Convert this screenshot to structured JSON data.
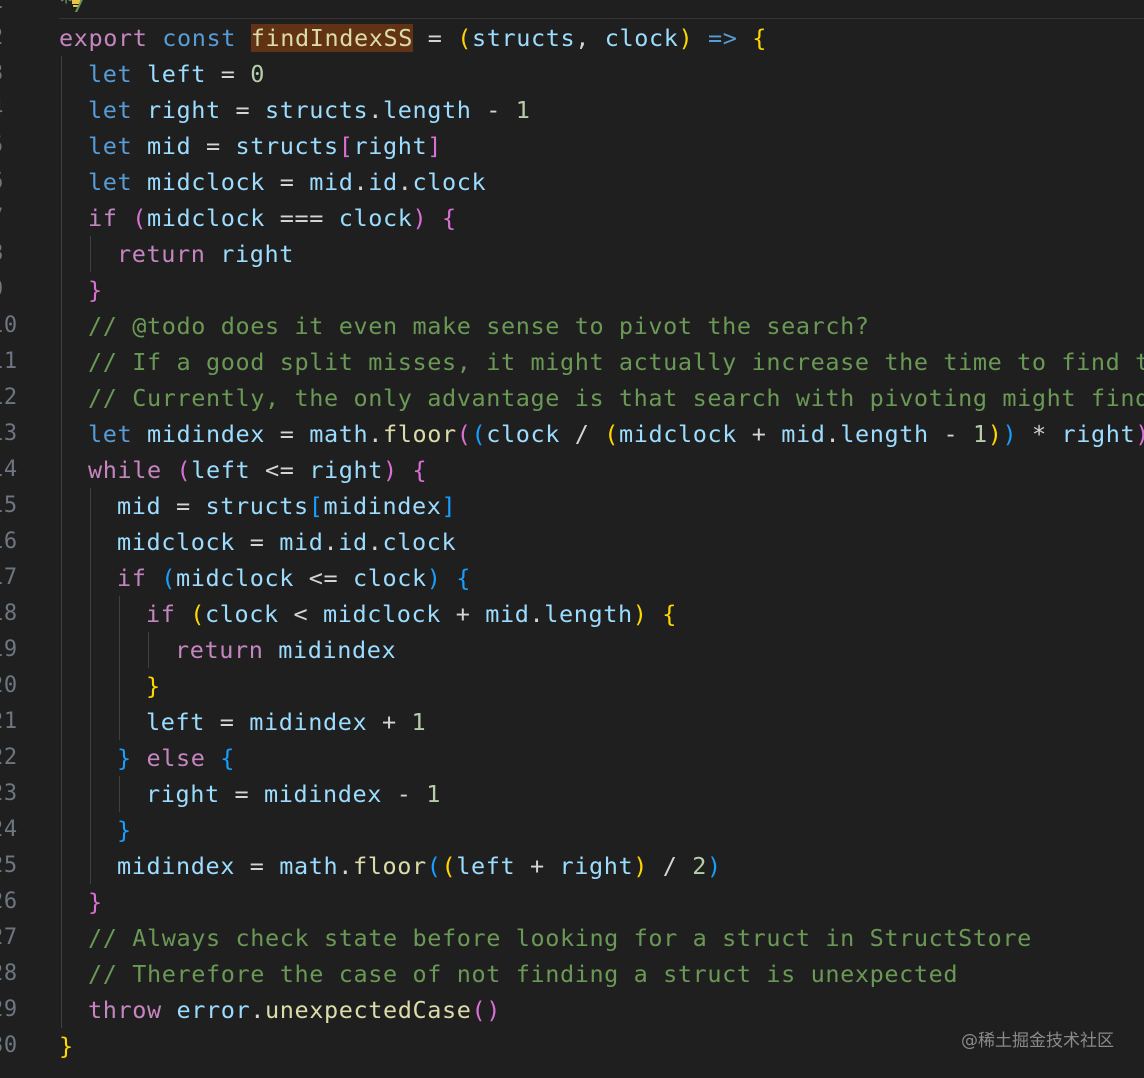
{
  "editor": {
    "lines": [
      {
        "n": "1",
        "indent": 0,
        "tokens": [
          {
            "t": "*/",
            "c": "k-cm"
          }
        ]
      },
      {
        "n": "2",
        "indent": 0,
        "tokens": [
          {
            "t": "export",
            "c": "k-kw"
          },
          {
            "t": " ",
            "c": "k-op"
          },
          {
            "t": "const",
            "c": "k-st"
          },
          {
            "t": " ",
            "c": "k-op"
          },
          {
            "t": "findIndexSS",
            "c": "k-fn hl"
          },
          {
            "t": " = ",
            "c": "k-op"
          },
          {
            "t": "(",
            "c": "k-b1"
          },
          {
            "t": "structs",
            "c": "k-var"
          },
          {
            "t": ", ",
            "c": "k-op"
          },
          {
            "t": "clock",
            "c": "k-var"
          },
          {
            "t": ")",
            "c": "k-b1"
          },
          {
            "t": " ",
            "c": "k-op"
          },
          {
            "t": "=>",
            "c": "k-st"
          },
          {
            "t": " ",
            "c": "k-op"
          },
          {
            "t": "{",
            "c": "k-b1"
          }
        ]
      },
      {
        "n": "3",
        "indent": 1,
        "tokens": [
          {
            "t": "let",
            "c": "k-st"
          },
          {
            "t": " ",
            "c": "k-op"
          },
          {
            "t": "left",
            "c": "k-var"
          },
          {
            "t": " = ",
            "c": "k-op"
          },
          {
            "t": "0",
            "c": "k-num"
          }
        ]
      },
      {
        "n": "4",
        "indent": 1,
        "tokens": [
          {
            "t": "let",
            "c": "k-st"
          },
          {
            "t": " ",
            "c": "k-op"
          },
          {
            "t": "right",
            "c": "k-var"
          },
          {
            "t": " = ",
            "c": "k-op"
          },
          {
            "t": "structs",
            "c": "k-var"
          },
          {
            "t": ".",
            "c": "k-op"
          },
          {
            "t": "length",
            "c": "k-var"
          },
          {
            "t": " - ",
            "c": "k-op"
          },
          {
            "t": "1",
            "c": "k-num"
          }
        ]
      },
      {
        "n": "5",
        "indent": 1,
        "tokens": [
          {
            "t": "let",
            "c": "k-st"
          },
          {
            "t": " ",
            "c": "k-op"
          },
          {
            "t": "mid",
            "c": "k-var"
          },
          {
            "t": " = ",
            "c": "k-op"
          },
          {
            "t": "structs",
            "c": "k-var"
          },
          {
            "t": "[",
            "c": "k-b2"
          },
          {
            "t": "right",
            "c": "k-var"
          },
          {
            "t": "]",
            "c": "k-b2"
          }
        ]
      },
      {
        "n": "6",
        "indent": 1,
        "tokens": [
          {
            "t": "let",
            "c": "k-st"
          },
          {
            "t": " ",
            "c": "k-op"
          },
          {
            "t": "midclock",
            "c": "k-var"
          },
          {
            "t": " = ",
            "c": "k-op"
          },
          {
            "t": "mid",
            "c": "k-var"
          },
          {
            "t": ".",
            "c": "k-op"
          },
          {
            "t": "id",
            "c": "k-var"
          },
          {
            "t": ".",
            "c": "k-op"
          },
          {
            "t": "clock",
            "c": "k-var"
          }
        ]
      },
      {
        "n": "7",
        "indent": 1,
        "tokens": [
          {
            "t": "if",
            "c": "k-kw"
          },
          {
            "t": " ",
            "c": "k-op"
          },
          {
            "t": "(",
            "c": "k-b2"
          },
          {
            "t": "midclock",
            "c": "k-var"
          },
          {
            "t": " === ",
            "c": "k-op"
          },
          {
            "t": "clock",
            "c": "k-var"
          },
          {
            "t": ")",
            "c": "k-b2"
          },
          {
            "t": " ",
            "c": "k-op"
          },
          {
            "t": "{",
            "c": "k-b2"
          }
        ]
      },
      {
        "n": "8",
        "indent": 2,
        "tokens": [
          {
            "t": "return",
            "c": "k-kw"
          },
          {
            "t": " ",
            "c": "k-op"
          },
          {
            "t": "right",
            "c": "k-var"
          }
        ]
      },
      {
        "n": "9",
        "indent": 1,
        "tokens": [
          {
            "t": "}",
            "c": "k-b2"
          }
        ]
      },
      {
        "n": "10",
        "indent": 1,
        "tokens": [
          {
            "t": "// @todo does it even make sense to pivot the search?",
            "c": "k-cm"
          }
        ]
      },
      {
        "n": "11",
        "indent": 1,
        "tokens": [
          {
            "t": "// If a good split misses, it might actually increase the time to find the",
            "c": "k-cm"
          }
        ]
      },
      {
        "n": "12",
        "indent": 1,
        "tokens": [
          {
            "t": "// Currently, the only advantage is that search with pivoting might find t",
            "c": "k-cm"
          }
        ]
      },
      {
        "n": "13",
        "indent": 1,
        "tokens": [
          {
            "t": "let",
            "c": "k-st"
          },
          {
            "t": " ",
            "c": "k-op"
          },
          {
            "t": "midindex",
            "c": "k-var"
          },
          {
            "t": " = ",
            "c": "k-op"
          },
          {
            "t": "math",
            "c": "k-var"
          },
          {
            "t": ".",
            "c": "k-op"
          },
          {
            "t": "floor",
            "c": "k-fn"
          },
          {
            "t": "(",
            "c": "k-b2"
          },
          {
            "t": "(",
            "c": "k-b3"
          },
          {
            "t": "clock",
            "c": "k-var"
          },
          {
            "t": " / ",
            "c": "k-op"
          },
          {
            "t": "(",
            "c": "k-b1"
          },
          {
            "t": "midclock",
            "c": "k-var"
          },
          {
            "t": " + ",
            "c": "k-op"
          },
          {
            "t": "mid",
            "c": "k-var"
          },
          {
            "t": ".",
            "c": "k-op"
          },
          {
            "t": "length",
            "c": "k-var"
          },
          {
            "t": " - ",
            "c": "k-op"
          },
          {
            "t": "1",
            "c": "k-num"
          },
          {
            "t": ")",
            "c": "k-b1"
          },
          {
            "t": ")",
            "c": "k-b3"
          },
          {
            "t": " * ",
            "c": "k-op"
          },
          {
            "t": "right",
            "c": "k-var"
          },
          {
            "t": ")",
            "c": "k-b2"
          }
        ]
      },
      {
        "n": "14",
        "indent": 1,
        "tokens": [
          {
            "t": "while",
            "c": "k-kw"
          },
          {
            "t": " ",
            "c": "k-op"
          },
          {
            "t": "(",
            "c": "k-b2"
          },
          {
            "t": "left",
            "c": "k-var"
          },
          {
            "t": " <= ",
            "c": "k-op"
          },
          {
            "t": "right",
            "c": "k-var"
          },
          {
            "t": ")",
            "c": "k-b2"
          },
          {
            "t": " ",
            "c": "k-op"
          },
          {
            "t": "{",
            "c": "k-b2"
          }
        ]
      },
      {
        "n": "15",
        "indent": 2,
        "tokens": [
          {
            "t": "mid",
            "c": "k-var"
          },
          {
            "t": " = ",
            "c": "k-op"
          },
          {
            "t": "structs",
            "c": "k-var"
          },
          {
            "t": "[",
            "c": "k-b3"
          },
          {
            "t": "midindex",
            "c": "k-var"
          },
          {
            "t": "]",
            "c": "k-b3"
          }
        ]
      },
      {
        "n": "16",
        "indent": 2,
        "tokens": [
          {
            "t": "midclock",
            "c": "k-var"
          },
          {
            "t": " = ",
            "c": "k-op"
          },
          {
            "t": "mid",
            "c": "k-var"
          },
          {
            "t": ".",
            "c": "k-op"
          },
          {
            "t": "id",
            "c": "k-var"
          },
          {
            "t": ".",
            "c": "k-op"
          },
          {
            "t": "clock",
            "c": "k-var"
          }
        ]
      },
      {
        "n": "17",
        "indent": 2,
        "tokens": [
          {
            "t": "if",
            "c": "k-kw"
          },
          {
            "t": " ",
            "c": "k-op"
          },
          {
            "t": "(",
            "c": "k-b3"
          },
          {
            "t": "midclock",
            "c": "k-var"
          },
          {
            "t": " <= ",
            "c": "k-op"
          },
          {
            "t": "clock",
            "c": "k-var"
          },
          {
            "t": ")",
            "c": "k-b3"
          },
          {
            "t": " ",
            "c": "k-op"
          },
          {
            "t": "{",
            "c": "k-b3"
          }
        ]
      },
      {
        "n": "18",
        "indent": 3,
        "tokens": [
          {
            "t": "if",
            "c": "k-kw"
          },
          {
            "t": " ",
            "c": "k-op"
          },
          {
            "t": "(",
            "c": "k-b1"
          },
          {
            "t": "clock",
            "c": "k-var"
          },
          {
            "t": " < ",
            "c": "k-op"
          },
          {
            "t": "midclock",
            "c": "k-var"
          },
          {
            "t": " + ",
            "c": "k-op"
          },
          {
            "t": "mid",
            "c": "k-var"
          },
          {
            "t": ".",
            "c": "k-op"
          },
          {
            "t": "length",
            "c": "k-var"
          },
          {
            "t": ")",
            "c": "k-b1"
          },
          {
            "t": " ",
            "c": "k-op"
          },
          {
            "t": "{",
            "c": "k-b1"
          }
        ]
      },
      {
        "n": "19",
        "indent": 4,
        "tokens": [
          {
            "t": "return",
            "c": "k-kw"
          },
          {
            "t": " ",
            "c": "k-op"
          },
          {
            "t": "midindex",
            "c": "k-var"
          }
        ]
      },
      {
        "n": "20",
        "indent": 3,
        "tokens": [
          {
            "t": "}",
            "c": "k-b1"
          }
        ]
      },
      {
        "n": "21",
        "indent": 3,
        "tokens": [
          {
            "t": "left",
            "c": "k-var"
          },
          {
            "t": " = ",
            "c": "k-op"
          },
          {
            "t": "midindex",
            "c": "k-var"
          },
          {
            "t": " + ",
            "c": "k-op"
          },
          {
            "t": "1",
            "c": "k-num"
          }
        ]
      },
      {
        "n": "22",
        "indent": 2,
        "tokens": [
          {
            "t": "}",
            "c": "k-b3"
          },
          {
            "t": " ",
            "c": "k-op"
          },
          {
            "t": "else",
            "c": "k-kw"
          },
          {
            "t": " ",
            "c": "k-op"
          },
          {
            "t": "{",
            "c": "k-b3"
          }
        ]
      },
      {
        "n": "23",
        "indent": 3,
        "tokens": [
          {
            "t": "right",
            "c": "k-var"
          },
          {
            "t": " = ",
            "c": "k-op"
          },
          {
            "t": "midindex",
            "c": "k-var"
          },
          {
            "t": " - ",
            "c": "k-op"
          },
          {
            "t": "1",
            "c": "k-num"
          }
        ]
      },
      {
        "n": "24",
        "indent": 2,
        "tokens": [
          {
            "t": "}",
            "c": "k-b3"
          }
        ]
      },
      {
        "n": "25",
        "indent": 2,
        "tokens": [
          {
            "t": "midindex",
            "c": "k-var"
          },
          {
            "t": " = ",
            "c": "k-op"
          },
          {
            "t": "math",
            "c": "k-var"
          },
          {
            "t": ".",
            "c": "k-op"
          },
          {
            "t": "floor",
            "c": "k-fn"
          },
          {
            "t": "(",
            "c": "k-b3"
          },
          {
            "t": "(",
            "c": "k-b1"
          },
          {
            "t": "left",
            "c": "k-var"
          },
          {
            "t": " + ",
            "c": "k-op"
          },
          {
            "t": "right",
            "c": "k-var"
          },
          {
            "t": ")",
            "c": "k-b1"
          },
          {
            "t": " / ",
            "c": "k-op"
          },
          {
            "t": "2",
            "c": "k-num"
          },
          {
            "t": ")",
            "c": "k-b3"
          }
        ]
      },
      {
        "n": "26",
        "indent": 1,
        "tokens": [
          {
            "t": "}",
            "c": "k-b2"
          }
        ]
      },
      {
        "n": "27",
        "indent": 1,
        "tokens": [
          {
            "t": "// Always check state before looking for a struct in StructStore",
            "c": "k-cm"
          }
        ]
      },
      {
        "n": "28",
        "indent": 1,
        "tokens": [
          {
            "t": "// Therefore the case of not finding a struct is unexpected",
            "c": "k-cm"
          }
        ]
      },
      {
        "n": "29",
        "indent": 1,
        "tokens": [
          {
            "t": "throw",
            "c": "k-kw"
          },
          {
            "t": " ",
            "c": "k-op"
          },
          {
            "t": "error",
            "c": "k-var"
          },
          {
            "t": ".",
            "c": "k-op"
          },
          {
            "t": "unexpectedCase",
            "c": "k-fn"
          },
          {
            "t": "(",
            "c": "k-b2"
          },
          {
            "t": ")",
            "c": "k-b2"
          }
        ]
      },
      {
        "n": "30",
        "indent": 0,
        "tokens": [
          {
            "t": "}",
            "c": "k-b1"
          }
        ]
      }
    ]
  },
  "watermark": "@稀土掘金技术社区",
  "icons": {
    "lightbulb": "lightbulb-icon"
  }
}
